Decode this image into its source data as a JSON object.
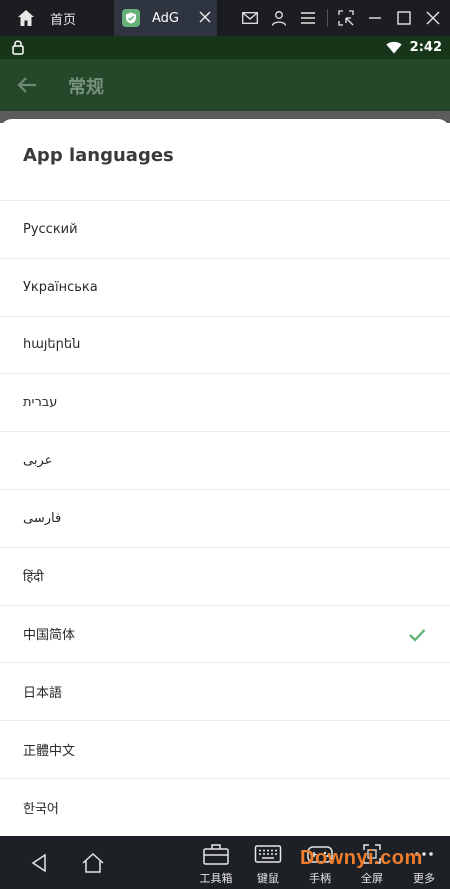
{
  "window": {
    "home_tab_label": "首页",
    "app_tab_label": "AdG",
    "icons": [
      "home-icon",
      "mail-icon",
      "user-icon",
      "menu-icon",
      "screen-select-icon",
      "minimize-icon",
      "maximize-icon",
      "close-icon"
    ]
  },
  "status_bar": {
    "time": "2:42",
    "icons": [
      "vpn-lock-icon",
      "wifi-icon",
      "battery-icon"
    ]
  },
  "app_toolbar": {
    "title": "常规",
    "back_icon": "arrow-left-icon"
  },
  "sheet": {
    "title": "App languages",
    "languages": [
      {
        "label": "Русский",
        "selected": false
      },
      {
        "label": "Українська",
        "selected": false
      },
      {
        "label": "հայերեն",
        "selected": false
      },
      {
        "label": "עברית",
        "selected": false
      },
      {
        "label": "عربى",
        "selected": false
      },
      {
        "label": "فارسی",
        "selected": false
      },
      {
        "label": "हिंदी",
        "selected": false
      },
      {
        "label": "中国简体",
        "selected": true
      },
      {
        "label": "日本語",
        "selected": false
      },
      {
        "label": "正體中文",
        "selected": false
      },
      {
        "label": "한국어",
        "selected": false
      }
    ],
    "check_color": "#67b279"
  },
  "bottom_bar": {
    "tools": [
      {
        "label": "工具箱",
        "icon": "toolbox-icon"
      },
      {
        "label": "键鼠",
        "icon": "keyboard-icon"
      },
      {
        "label": "手柄",
        "icon": "gamepad-icon"
      },
      {
        "label": "全屏",
        "icon": "fullscreen-icon"
      },
      {
        "label": "更多",
        "icon": "more-icon"
      }
    ]
  },
  "watermark": "Downyi.com"
}
